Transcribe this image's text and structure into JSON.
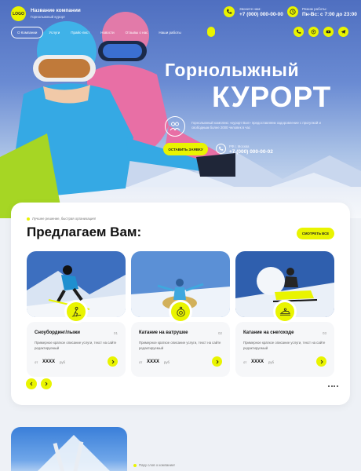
{
  "header": {
    "logo": "LOGO",
    "company_name": "Название компании",
    "company_sub": "Горнолыжный курорт",
    "call_label": "Звоните нам:",
    "phone": "+7 (000) 000-00-00",
    "hours_label": "Режим работы:",
    "hours": "Пн-Вс: с 7:00 до 23:00"
  },
  "nav": {
    "items": [
      "О Компании",
      "Услуги",
      "Прайс-лист",
      "Новости",
      "Отзывы о нас",
      "Наши работы"
    ]
  },
  "social_icons": [
    "phone-icon",
    "whatsapp-icon",
    "vk-icon",
    "youtube-icon",
    "telegram-icon"
  ],
  "hero": {
    "title_line1": "Горнолыжный",
    "title_line2": "КУРОРТ",
    "description": "Горнолыжный комплекс «курорт Вал» предоставляем оздоровление с прогулкой и свободным более 2000 человек в час",
    "cta_label": "ОСТАВИТЬ ЗАЯВКУ",
    "city": "РФ г. Москва",
    "phone": "+7 (000) 000-00-02"
  },
  "offer": {
    "eyebrow": "Лучшее решение, быстрая организация!",
    "title": "Предлагаем Вам:",
    "see_all_label": "СМОТРЕТЬ ВСЕ",
    "services": [
      {
        "name": "Сноубординг/лыжи",
        "num": "01",
        "text": "Примерное краткое описание услуги, текст на сайте редактируемый",
        "from": "от",
        "price": "XXXX",
        "currency": "руб",
        "icon": "skier-icon"
      },
      {
        "name": "Катание на ватрушке",
        "num": "02",
        "text": "Примерное краткое описание услуги, текст на сайте редактируемый",
        "from": "от",
        "price": "XXXX",
        "currency": "руб",
        "icon": "tubing-icon"
      },
      {
        "name": "Катание на снегоходе",
        "num": "03",
        "text": "Примерное краткое описание услуги, текст на сайте редактируемый",
        "from": "от",
        "price": "XXXX",
        "currency": "руб",
        "icon": "snowmobile-icon"
      }
    ]
  },
  "about": {
    "eyebrow": "Пару слов о компании!"
  },
  "colors": {
    "accent": "#e9f400",
    "hero_sky": "#5a7bcb",
    "card_bg": "#ffffff"
  }
}
